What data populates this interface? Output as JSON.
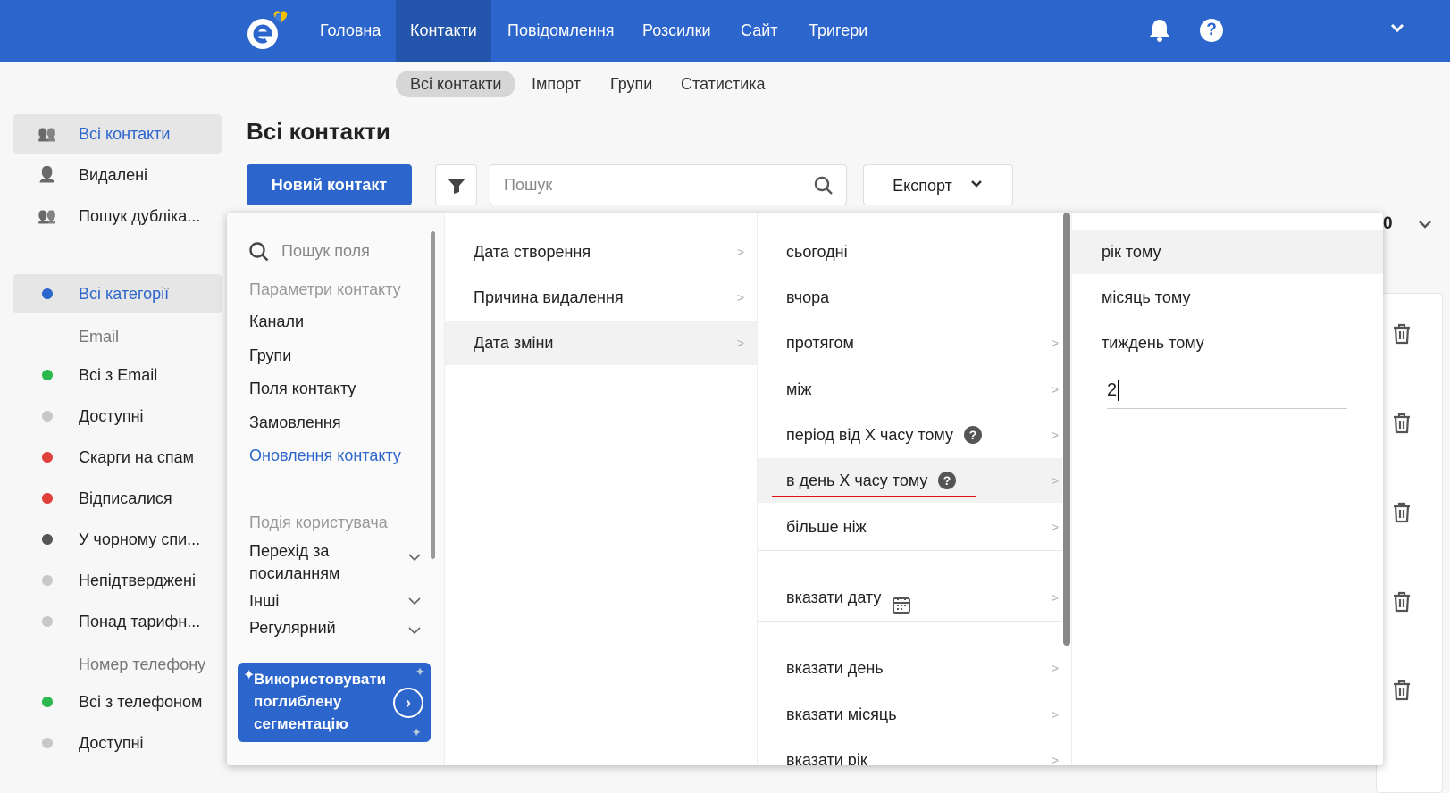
{
  "colors": {
    "brand": "#2c66cc",
    "active_nav": "#2455ad",
    "link": "#2c66cc",
    "green": "#2db84d",
    "grey": "#c8c8c8",
    "red": "#e0403a",
    "dark": "#555555",
    "underline": "#e01010"
  },
  "topnav": {
    "items": [
      "Головна",
      "Контакти",
      "Повідомлення",
      "Розсилки",
      "Сайт",
      "Тригери"
    ],
    "active": 1
  },
  "subnav": {
    "items": [
      "Всі контакти",
      "Імпорт",
      "Групи",
      "Статистика"
    ],
    "active": 0
  },
  "sidebar": {
    "top": [
      {
        "label": "Всі контакти",
        "icon": "users-icon"
      },
      {
        "label": "Видалені",
        "icon": "user-x-icon"
      },
      {
        "label": "Пошук дублікатів",
        "display": "Пошук дубліка..."
      }
    ],
    "categories_all": "Всі категорії",
    "email_header": "Email",
    "email": [
      {
        "label": "Всі з Email",
        "color": "green"
      },
      {
        "label": "Доступні",
        "color": "grey"
      },
      {
        "label": "Скарги на спам",
        "color": "red"
      },
      {
        "label": "Відписалися",
        "color": "red"
      },
      {
        "label": "У чорному спи...",
        "color": "dark"
      },
      {
        "label": "Непідтверджені",
        "color": "grey"
      },
      {
        "label": "Понад тарифн...",
        "color": "grey"
      }
    ],
    "phone_header": "Номер телефону",
    "phone": [
      {
        "label": "Всі з телефоном",
        "color": "green"
      },
      {
        "label": "Доступні",
        "color": "grey"
      }
    ]
  },
  "page": {
    "title": "Всі контакти",
    "new_contact": "Новий контакт",
    "search_placeholder": "Пошук",
    "export": "Експорт",
    "count_fragment": "0"
  },
  "menu": {
    "search_placeholder": "Пошук поля",
    "contact_params_header": "Параметри контакту",
    "contact_params": [
      "Канали",
      "Групи",
      "Поля контакту",
      "Замовлення",
      "Оновлення контакту"
    ],
    "contact_params_active": 4,
    "user_event_header": "Подія користувача",
    "user_events": [
      "Перехід за посиланням",
      "Інші",
      "Регулярний"
    ],
    "promo": "Використовувати поглиблену сегментацію",
    "fields": [
      "Дата створення",
      "Причина видалення",
      "Дата зміни"
    ],
    "fields_active": 2,
    "conditions": [
      {
        "label": "сьогодні",
        "chevron": false
      },
      {
        "label": "вчора",
        "chevron": false
      },
      {
        "label": "протягом",
        "chevron": true
      },
      {
        "label": "між",
        "chevron": true
      },
      {
        "label": "період від X часу тому",
        "chevron": true,
        "help": true
      },
      {
        "label": "в день X часу тому",
        "chevron": true,
        "help": true
      },
      {
        "label": "більше ніж",
        "chevron": true
      },
      {
        "label": "вказати дату",
        "chevron": true,
        "calendar": true
      },
      {
        "label": "вказати день",
        "chevron": true
      },
      {
        "label": "вказати місяць",
        "chevron": true
      },
      {
        "label": "вказати рік",
        "chevron": true
      }
    ],
    "conditions_active": 5,
    "periods": [
      "рік тому",
      "місяць тому",
      "тиждень тому"
    ],
    "periods_active": 0,
    "value_input": "2"
  }
}
